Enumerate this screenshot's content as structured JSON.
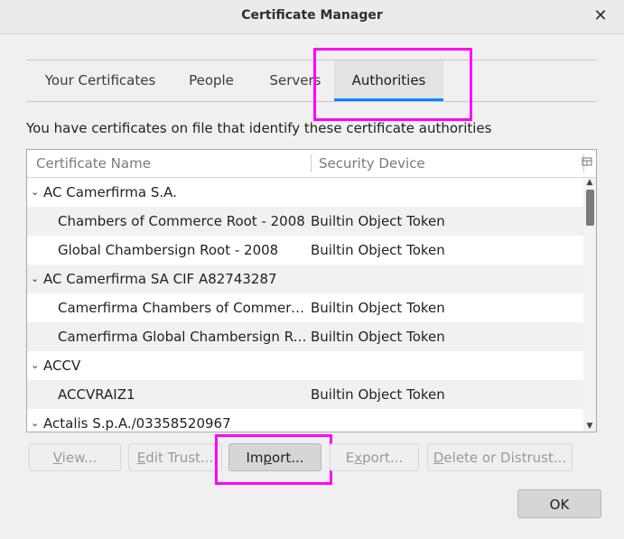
{
  "window": {
    "title": "Certificate Manager",
    "close_glyph": "✕"
  },
  "tabs": [
    {
      "label": "Your Certificates",
      "selected": false
    },
    {
      "label": "People",
      "selected": false
    },
    {
      "label": "Servers",
      "selected": false
    },
    {
      "label": "Authorities",
      "selected": true
    }
  ],
  "description": "You have certificates on file that identify these certificate authorities",
  "columns": {
    "name": "Certificate Name",
    "device": "Security Device"
  },
  "rows": [
    {
      "type": "group",
      "twisty": "⌄",
      "name": "AC Camerfirma S.A.",
      "device": ""
    },
    {
      "type": "cert",
      "name": "Chambers of Commerce Root - 2008",
      "device": "Builtin Object Token"
    },
    {
      "type": "cert",
      "name": "Global Chambersign Root - 2008",
      "device": "Builtin Object Token"
    },
    {
      "type": "group",
      "twisty": "⌄",
      "name": "AC Camerfirma SA CIF A82743287",
      "device": ""
    },
    {
      "type": "cert",
      "name": "Camerfirma Chambers of Commerce Root",
      "device": "Builtin Object Token"
    },
    {
      "type": "cert",
      "name": "Camerfirma Global Chambersign Root",
      "device": "Builtin Object Token"
    },
    {
      "type": "group",
      "twisty": "⌄",
      "name": "ACCV",
      "device": ""
    },
    {
      "type": "cert",
      "name": "ACCVRAIZ1",
      "device": "Builtin Object Token"
    },
    {
      "type": "group",
      "twisty": "⌄",
      "name": "Actalis S.p.A./03358520967",
      "device": ""
    }
  ],
  "buttons": {
    "view": {
      "label": "View...",
      "access": "V",
      "rest": "iew..."
    },
    "edit_trust": {
      "label": "Edit Trust...",
      "access": "E",
      "rest": "dit Trust..."
    },
    "import": {
      "label": "Import...",
      "pre": "Im",
      "access": "p",
      "rest": "ort..."
    },
    "export": {
      "label": "Export...",
      "pre": "E",
      "access": "x",
      "rest": "port..."
    },
    "delete": {
      "label": "Delete or Distrust...",
      "access": "D",
      "rest": "elete or Distrust..."
    },
    "ok": {
      "label": "OK"
    }
  },
  "colors": {
    "highlight": "#ff00ff",
    "accent": "#0a84ff"
  }
}
